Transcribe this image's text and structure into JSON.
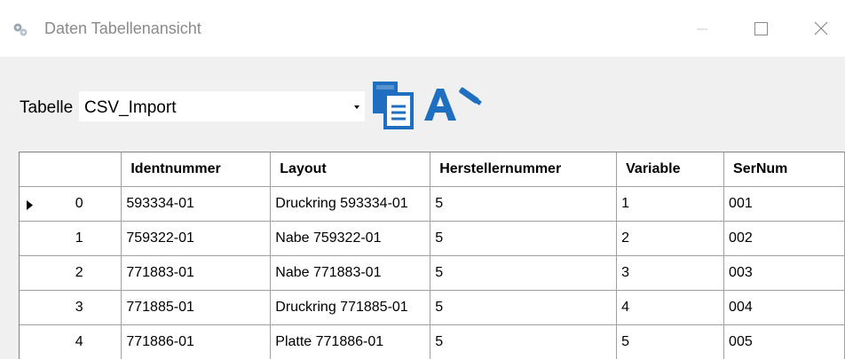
{
  "window": {
    "title": "Daten Tabellenansicht",
    "controls": {
      "minimize": "minimize-icon",
      "maximize": "maximize-icon",
      "close": "close-icon"
    }
  },
  "toolbar": {
    "table_label": "Tabelle",
    "table_select_value": "CSV_Import",
    "copy_icon": "copy-icon",
    "format_icon": "font-format-icon",
    "accent_color": "#1e6fbf"
  },
  "grid": {
    "columns": [
      "Identnummer",
      "Layout",
      "Herstellernummer",
      "Variable",
      "SerNum"
    ],
    "current_row": 0,
    "rows": [
      {
        "index": "0",
        "cells": [
          "593334-01",
          "Druckring 593334-01",
          "5",
          "1",
          "001"
        ]
      },
      {
        "index": "1",
        "cells": [
          "759322-01",
          "Nabe 759322-01",
          "5",
          "2",
          "002"
        ]
      },
      {
        "index": "2",
        "cells": [
          "771883-01",
          "Nabe 771883-01",
          "5",
          "3",
          "003"
        ]
      },
      {
        "index": "3",
        "cells": [
          "771885-01",
          "Druckring 771885-01",
          "5",
          "4",
          "004"
        ]
      },
      {
        "index": "4",
        "cells": [
          "771886-01",
          "Platte 771886-01",
          "5",
          "5",
          "005"
        ]
      }
    ]
  }
}
